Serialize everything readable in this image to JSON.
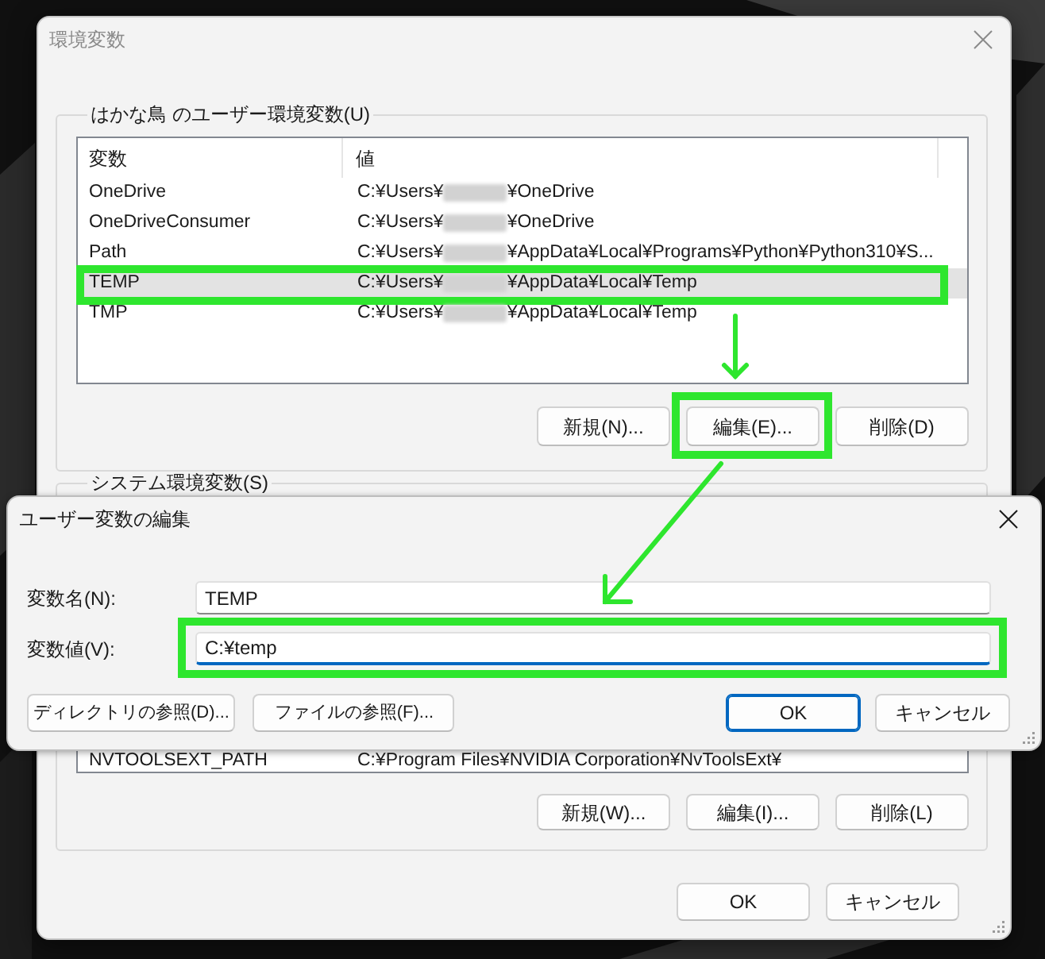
{
  "settings_window": {
    "title": "環境変数",
    "active": false,
    "user_variables": {
      "label": "はかな鳥 のユーザー環境変数(U)",
      "columns": [
        "変数",
        "値"
      ],
      "rows": [
        {
          "name": "OneDrive",
          "value_start": "C:¥Users¥",
          "redacted": true,
          "value_end": "¥OneDrive",
          "selected": false,
          "highlighted": false
        },
        {
          "name": "OneDriveConsumer",
          "value_start": "C:¥Users¥",
          "redacted": true,
          "value_end": "¥OneDrive",
          "selected": false,
          "highlighted": false
        },
        {
          "name": "Path",
          "value_start": "C:¥Users¥",
          "redacted": true,
          "value_end": "¥AppData¥Local¥Programs¥Python¥Python310¥S...",
          "selected": false,
          "highlighted": false
        },
        {
          "name": "TEMP",
          "value_start": "C:¥Users¥",
          "redacted": true,
          "value_end": "¥AppData¥Local¥Temp",
          "selected": true,
          "highlighted": true
        },
        {
          "name": "TMP",
          "value_start": "C:¥Users¥",
          "redacted": true,
          "value_end": "¥AppData¥Local¥Temp",
          "selected": false,
          "highlighted": false
        }
      ],
      "buttons": [
        {
          "label": "新規(N)...",
          "highlighted": false
        },
        {
          "label": "編集(E)...",
          "highlighted": true
        },
        {
          "label": "削除(D)",
          "highlighted": false
        }
      ]
    },
    "system_variables": {
      "label": "システム環境変数(S)",
      "rows": [
        {
          "name": "NVTOOLSEXT_PATH",
          "value": "C:¥Program Files¥NVIDIA Corporation¥NvToolsExt¥"
        }
      ],
      "buttons": [
        "新規(W)...",
        "編集(I)...",
        "削除(L)"
      ]
    },
    "buttons": [
      "OK",
      "キャンセル"
    ]
  },
  "edit_dialog": {
    "title": "ユーザー変数の編集",
    "active": true,
    "fields": [
      {
        "label": "変数名(N):",
        "value": "TEMP",
        "focused": false,
        "highlighted": false
      },
      {
        "label": "変数値(V):",
        "value": "C:¥temp",
        "focused": true,
        "highlighted": true
      }
    ],
    "browse_buttons": [
      "ディレクトリの参照(D)...",
      "ファイルの参照(F)..."
    ],
    "buttons": [
      {
        "label": "OK",
        "default": true
      },
      {
        "label": "キャンセル",
        "default": false
      }
    ]
  }
}
